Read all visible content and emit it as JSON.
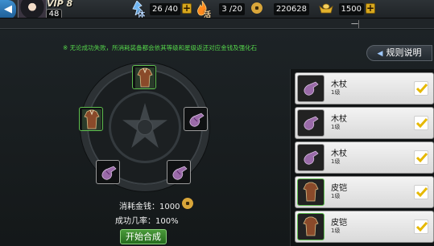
{
  "header": {
    "back_icon": "back-arrow-icon",
    "vip_label": "VIP 8",
    "player_level": "48",
    "stamina_label": "体",
    "stamina_value": "26 /40",
    "vigor_label": "活",
    "vigor_value": "3 /20",
    "gold_value": "220628",
    "ingot_value": "1500",
    "strip_tag": "一"
  },
  "panel": {
    "tip": "※ 无论成功失败，所消耗装备都会依其等级和星级返还对应金钱及强化石",
    "rules_button": "规则说明",
    "cost_label": "消耗金钱：1000",
    "success_rate_label": "成功几率：100%",
    "start_button": "开始合成"
  },
  "slots": [
    {
      "type": "armor",
      "rarity": "green"
    },
    {
      "type": "armor",
      "rarity": "green"
    },
    {
      "type": "glove",
      "rarity": "white"
    },
    {
      "type": "glove",
      "rarity": "white"
    },
    {
      "type": "glove",
      "rarity": "white"
    }
  ],
  "item_list": [
    {
      "name": "木杖",
      "level": "1级",
      "icon": "staff-glove-icon",
      "checked": true
    },
    {
      "name": "木杖",
      "level": "1级",
      "icon": "staff-glove-icon",
      "checked": true
    },
    {
      "name": "木杖",
      "level": "1级",
      "icon": "staff-glove-icon",
      "checked": true
    },
    {
      "name": "皮铠",
      "level": "1级",
      "icon": "leather-armor-icon",
      "checked": true
    },
    {
      "name": "皮铠",
      "level": "1级",
      "icon": "leather-armor-icon",
      "checked": true
    }
  ],
  "colors": {
    "tip_green": "#55d64b",
    "gold": "#d9a63a",
    "check_yellow": "#e6b800",
    "rarity_green": "#5fbf4f"
  }
}
